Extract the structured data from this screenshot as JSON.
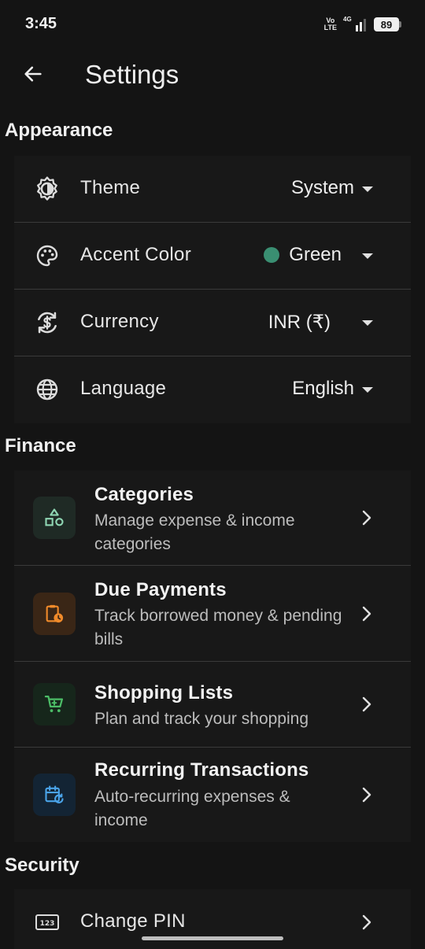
{
  "status_bar": {
    "time": "3:45",
    "network_type_top": "Vo",
    "network_type_bottom": "LTE",
    "signal_label": "4G",
    "battery": "89"
  },
  "header": {
    "title": "Settings",
    "back_icon": "arrow-left-icon"
  },
  "sections": {
    "appearance": {
      "title": "Appearance",
      "items": [
        {
          "icon": "brightness-icon",
          "label": "Theme",
          "value": "System"
        },
        {
          "icon": "palette-icon",
          "label": "Accent Color",
          "value": "Green",
          "accent_color": "#3a8f72"
        },
        {
          "icon": "currency-exchange-icon",
          "label": "Currency",
          "value": "INR (₹)"
        },
        {
          "icon": "globe-icon",
          "label": "Language",
          "value": "English"
        }
      ]
    },
    "finance": {
      "title": "Finance",
      "items": [
        {
          "icon": "shapes-icon",
          "title": "Categories",
          "description": "Manage expense & income categories",
          "tile_color": "#1f2a25",
          "icon_color": "#8fd6b3"
        },
        {
          "icon": "clipboard-clock-icon",
          "title": "Due Payments",
          "description": "Track borrowed money & pending bills",
          "tile_color": "#3a2616",
          "icon_color": "#f08a2a"
        },
        {
          "icon": "cart-icon",
          "title": "Shopping Lists",
          "description": "Plan and track your shopping",
          "tile_color": "#16261b",
          "icon_color": "#4cbd67"
        },
        {
          "icon": "calendar-repeat-icon",
          "title": "Recurring Transactions",
          "description": "Auto-recurring expenses & income",
          "tile_color": "#132434",
          "icon_color": "#4aa3e8"
        }
      ]
    },
    "security": {
      "title": "Security",
      "items": [
        {
          "icon": "pin-123-icon",
          "label": "Change PIN"
        }
      ]
    }
  },
  "colors": {
    "background": "#141414",
    "card": "#181818",
    "divider": "#3a3a3a"
  }
}
